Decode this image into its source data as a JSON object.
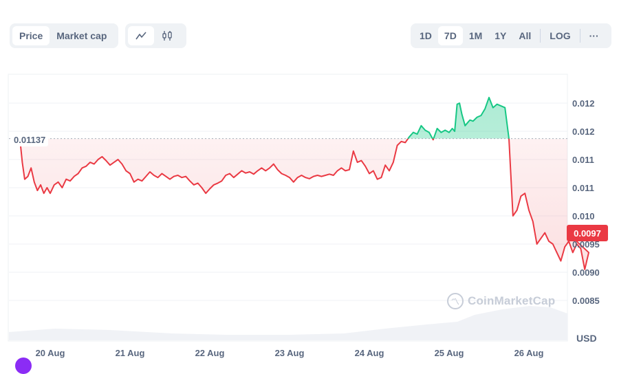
{
  "toolbar": {
    "type_tabs": [
      {
        "label": "Price",
        "active": true
      },
      {
        "label": "Market cap",
        "active": false
      }
    ],
    "view_tabs": [
      {
        "icon": "line-chart-icon",
        "glyph": "〰",
        "active": true
      },
      {
        "icon": "candlestick-icon",
        "glyph": "⫼",
        "active": false
      }
    ],
    "range_tabs": [
      {
        "label": "1D",
        "active": false
      },
      {
        "label": "7D",
        "active": true
      },
      {
        "label": "1M",
        "active": false
      },
      {
        "label": "1Y",
        "active": false
      },
      {
        "label": "All",
        "active": false
      }
    ],
    "log_label": "LOG",
    "more_label": "···"
  },
  "watermark": "CoinMarketCap",
  "currency": "USD",
  "colors": {
    "up": "#16c784",
    "down": "#ea3943",
    "grid": "#eff2f5",
    "text": "#58667e"
  },
  "chart_data": {
    "type": "line",
    "title": "",
    "xlabel": "",
    "ylabel": "USD",
    "reference_price": 0.01137,
    "reference_label": "0.01137",
    "current_price": 0.0097,
    "current_label": "0.0097",
    "ylim": [
      0.008,
      0.0124
    ],
    "yticks": [
      {
        "value": 0.012,
        "label": "0.012"
      },
      {
        "value": 0.0115,
        "label": "0.012"
      },
      {
        "value": 0.011,
        "label": "0.011"
      },
      {
        "value": 0.0105,
        "label": "0.011"
      },
      {
        "value": 0.01,
        "label": "0.010"
      },
      {
        "value": 0.0095,
        "label": "0.0095"
      },
      {
        "value": 0.009,
        "label": "0.0090"
      },
      {
        "value": 0.0085,
        "label": "0.0085"
      }
    ],
    "xlim": [
      19.6,
      27.0
    ],
    "xticks": [
      {
        "value": 20,
        "label": "20 Aug"
      },
      {
        "value": 21,
        "label": "21 Aug"
      },
      {
        "value": 22,
        "label": "22 Aug"
      },
      {
        "value": 23,
        "label": "23 Aug"
      },
      {
        "value": 24,
        "label": "24 Aug"
      },
      {
        "value": 25,
        "label": "25 Aug"
      },
      {
        "value": 26,
        "label": "26 Aug"
      }
    ],
    "grid": true,
    "series": [
      {
        "name": "Price",
        "x": [
          19.62,
          19.65,
          19.68,
          19.72,
          19.76,
          19.8,
          19.84,
          19.88,
          19.92,
          19.96,
          20.0,
          20.05,
          20.1,
          20.15,
          20.2,
          20.25,
          20.3,
          20.35,
          20.4,
          20.45,
          20.5,
          20.55,
          20.6,
          20.65,
          20.7,
          20.75,
          20.8,
          20.85,
          20.9,
          20.95,
          21.0,
          21.05,
          21.1,
          21.15,
          21.2,
          21.25,
          21.3,
          21.35,
          21.4,
          21.45,
          21.5,
          21.55,
          21.6,
          21.65,
          21.7,
          21.75,
          21.8,
          21.85,
          21.9,
          21.95,
          22.0,
          22.05,
          22.1,
          22.15,
          22.2,
          22.25,
          22.3,
          22.35,
          22.4,
          22.45,
          22.5,
          22.55,
          22.6,
          22.65,
          22.7,
          22.75,
          22.8,
          22.85,
          22.9,
          22.95,
          23.0,
          23.05,
          23.1,
          23.15,
          23.2,
          23.25,
          23.3,
          23.35,
          23.4,
          23.45,
          23.5,
          23.55,
          23.6,
          23.65,
          23.7,
          23.75,
          23.8,
          23.85,
          23.9,
          23.95,
          24.0,
          24.05,
          24.1,
          24.15,
          24.2,
          24.25,
          24.3,
          24.35,
          24.4,
          24.45,
          24.5,
          24.55,
          24.6,
          24.65,
          24.7,
          24.75,
          24.8,
          24.85,
          24.9,
          24.95,
          25.0,
          25.04,
          25.07,
          25.1,
          25.13,
          25.16,
          25.2,
          25.23,
          25.26,
          25.3,
          25.35,
          25.4,
          25.45,
          25.5,
          25.55,
          25.6,
          25.65,
          25.7,
          25.75,
          25.8,
          25.85,
          25.9,
          25.95,
          26.0,
          26.05,
          26.1,
          26.15,
          26.2,
          26.25,
          26.3,
          26.35,
          26.4,
          26.45,
          26.5,
          26.55,
          26.6,
          26.65,
          26.7,
          26.75
        ],
        "values": [
          0.01137,
          0.01095,
          0.01065,
          0.0107,
          0.01085,
          0.0106,
          0.01045,
          0.01055,
          0.0104,
          0.0105,
          0.0104,
          0.01055,
          0.0106,
          0.0105,
          0.01065,
          0.01062,
          0.0107,
          0.01075,
          0.01085,
          0.01088,
          0.01095,
          0.01092,
          0.011,
          0.01105,
          0.01098,
          0.0109,
          0.01095,
          0.011,
          0.01092,
          0.0108,
          0.01075,
          0.0106,
          0.01065,
          0.01062,
          0.0107,
          0.01078,
          0.01072,
          0.01068,
          0.01075,
          0.0107,
          0.01065,
          0.0107,
          0.01072,
          0.01068,
          0.0107,
          0.01062,
          0.01055,
          0.01058,
          0.0105,
          0.0104,
          0.01048,
          0.01055,
          0.01058,
          0.01062,
          0.01072,
          0.01075,
          0.01068,
          0.01074,
          0.0108,
          0.01076,
          0.01078,
          0.01074,
          0.0108,
          0.01085,
          0.0108,
          0.01085,
          0.01092,
          0.01082,
          0.01075,
          0.01072,
          0.01068,
          0.0106,
          0.01068,
          0.01072,
          0.01068,
          0.01066,
          0.0107,
          0.01072,
          0.0107,
          0.01072,
          0.01074,
          0.01072,
          0.0108,
          0.01085,
          0.0108,
          0.01082,
          0.01115,
          0.01095,
          0.01098,
          0.01088,
          0.01075,
          0.0108,
          0.01065,
          0.01068,
          0.0109,
          0.0108,
          0.01095,
          0.01125,
          0.01132,
          0.0113,
          0.0114,
          0.01148,
          0.01145,
          0.0116,
          0.01152,
          0.01148,
          0.01135,
          0.01155,
          0.01148,
          0.01152,
          0.01148,
          0.01155,
          0.0115,
          0.01198,
          0.012,
          0.0118,
          0.0116,
          0.01165,
          0.0117,
          0.01168,
          0.01175,
          0.01178,
          0.0119,
          0.0121,
          0.01192,
          0.01198,
          0.01195,
          0.01192,
          0.01137,
          0.01,
          0.0101,
          0.01035,
          0.0104,
          0.0101,
          0.0099,
          0.0095,
          0.0096,
          0.0097,
          0.00955,
          0.0095,
          0.00935,
          0.0092,
          0.00945,
          0.00955,
          0.00935,
          0.0095,
          0.00942,
          0.00905,
          0.00935,
          0.00955,
          0.0095,
          0.00962,
          0.00965,
          0.00978,
          0.01015,
          0.00975,
          0.00965,
          0.00958,
          0.00955,
          0.00962,
          0.0096,
          0.0097
        ]
      }
    ],
    "volume_area": true
  }
}
